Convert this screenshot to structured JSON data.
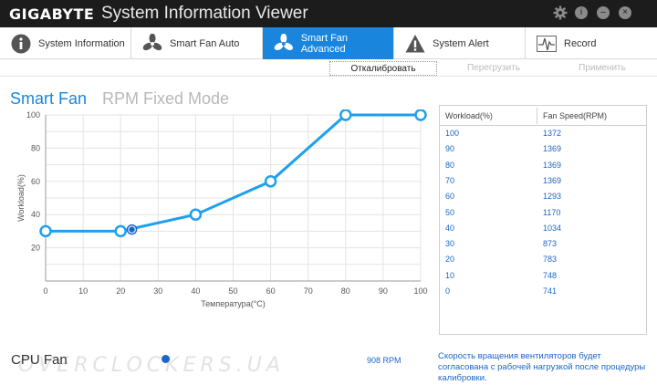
{
  "titlebar": {
    "brand": "GIGABYTE",
    "title": "System Information Viewer"
  },
  "tabs": [
    {
      "label": "System Information",
      "icon": "info-icon"
    },
    {
      "label": "Smart Fan Auto",
      "icon": "fan-icon"
    },
    {
      "label": "Smart Fan Advanced",
      "icon": "fan-icon",
      "active": true
    },
    {
      "label": "System Alert",
      "icon": "warning-icon"
    },
    {
      "label": "Record",
      "icon": "pulse-icon"
    }
  ],
  "actions": {
    "calibrate": "Откалибровать",
    "reload": "Перегрузить",
    "apply": "Применить"
  },
  "modes": {
    "smart": "Smart Fan",
    "rpm": "RPM Fixed Mode"
  },
  "chart_data": {
    "type": "line",
    "xlabel": "Температура(°C)",
    "ylabel": "Workload(%)",
    "xlim": [
      0,
      100
    ],
    "ylim": [
      0,
      100
    ],
    "xticks": [
      "0",
      "10",
      "20",
      "30",
      "40",
      "50",
      "60",
      "70",
      "80",
      "90",
      "100"
    ],
    "yticks": [
      "20",
      "40",
      "60",
      "80",
      "100"
    ],
    "grid": true,
    "series": [
      {
        "x": [
          0,
          20,
          40,
          60,
          80,
          100
        ],
        "values": [
          30,
          30,
          40,
          60,
          100,
          100
        ]
      }
    ],
    "current_point": {
      "x": 23,
      "y": 31
    }
  },
  "table": {
    "headers": [
      "Workload(%)",
      "Fan Speed(RPM)"
    ],
    "rows": [
      [
        "100",
        "1372"
      ],
      [
        "90",
        "1369"
      ],
      [
        "80",
        "1369"
      ],
      [
        "70",
        "1369"
      ],
      [
        "60",
        "1293"
      ],
      [
        "50",
        "1170"
      ],
      [
        "40",
        "1034"
      ],
      [
        "30",
        "873"
      ],
      [
        "20",
        "783"
      ],
      [
        "10",
        "748"
      ],
      [
        "0",
        "741"
      ]
    ]
  },
  "bottom": {
    "fan_name": "CPU Fan",
    "rpm": "908 RPM",
    "note": "Скорость вращения вентиляторов будет согласована с рабочей нагрузкой  после процедуры калибровки.",
    "watermark": "OVERCLOCKERS.UA"
  },
  "colors": {
    "accent": "#1985dd",
    "titlebar": "#1c1c1c",
    "value_text": "#1a66c8"
  }
}
